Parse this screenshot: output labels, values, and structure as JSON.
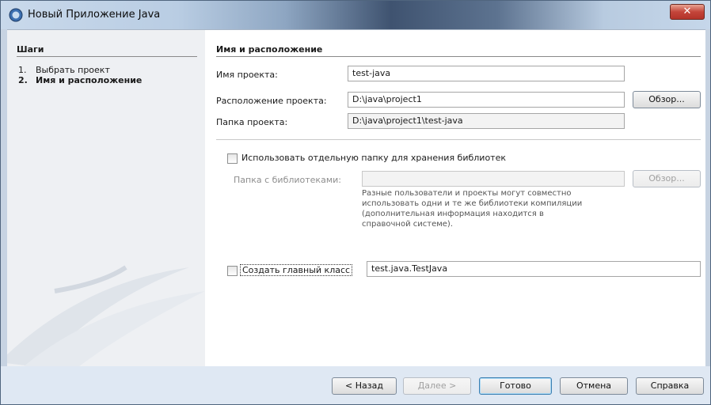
{
  "window": {
    "title": "Новый Приложение Java",
    "close_glyph": "✕",
    "app_icon": "netbeans-icon",
    "colors": {
      "title_bar": "#b9cde3",
      "close_button": "#c4453a",
      "frame": "#dfe8f3"
    }
  },
  "steps": {
    "header": "Шаги",
    "items": [
      {
        "num": "1.",
        "label": "Выбрать проект"
      },
      {
        "num": "2.",
        "label": "Имя и расположение"
      }
    ]
  },
  "section": {
    "title": "Имя и расположение"
  },
  "project": {
    "name_label": "Имя проекта:",
    "name_value": "test-java",
    "location_label": "Расположение проекта:",
    "location_value": "D:\\java\\project1",
    "browse_label": "Обзор...",
    "folder_label": "Папка проекта:",
    "folder_value": "D:\\java\\project1\\test-java"
  },
  "libraries": {
    "checkbox_label": "Использовать отдельную папку для хранения библиотек",
    "checked": false,
    "folder_label": "Папка с библиотеками:",
    "folder_value": "",
    "browse_label": "Обзор...",
    "note_lines": [
      "Разные пользователи и проекты могут совместно",
      "использовать одни и те же библиотеки компиляции",
      "(дополнительная информация находится в",
      "справочной системе)."
    ]
  },
  "main_class": {
    "checkbox_label": "Создать главный класс",
    "checked": false,
    "value": "test.java.TestJava"
  },
  "footer": {
    "back": "< Назад",
    "next": "Далее >",
    "finish": "Готово",
    "cancel": "Отмена",
    "help": "Справка"
  }
}
